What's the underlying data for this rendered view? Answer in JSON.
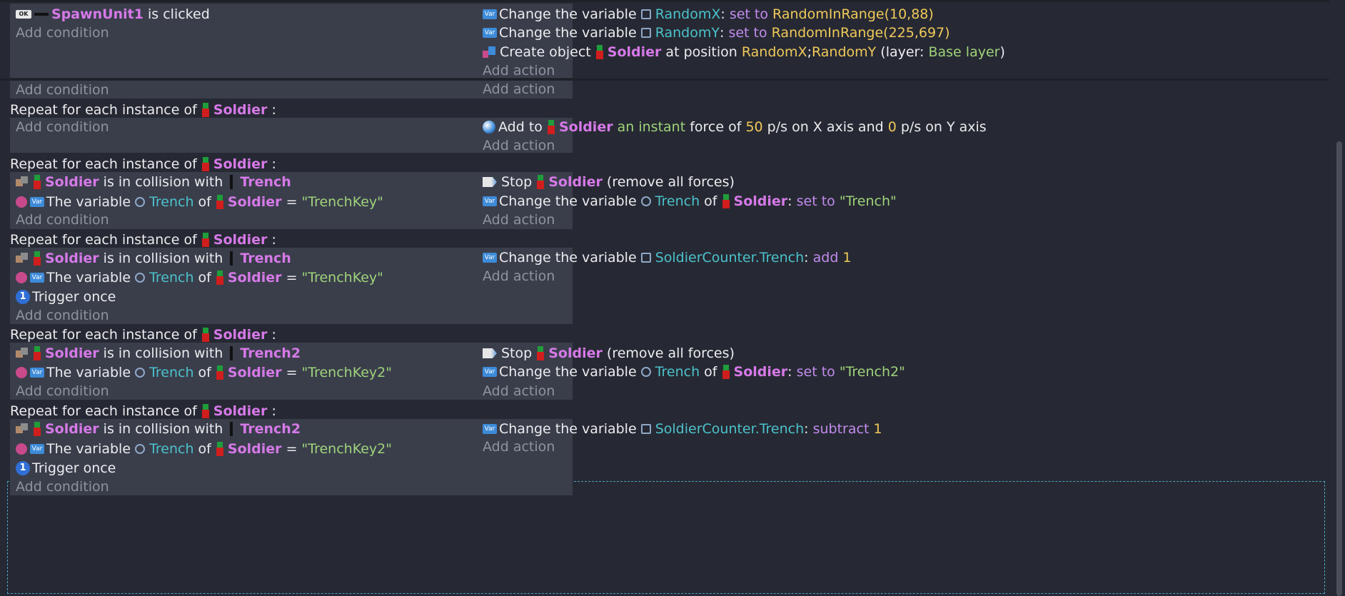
{
  "events": [
    {
      "conditions": [
        {
          "parts": [
            {
              "t": "icon",
              "name": "button-icon",
              "label": "OK"
            },
            {
              "t": "icon",
              "name": "black-bar-icon"
            },
            {
              "t": "obj",
              "v": "SpawnUnit1"
            },
            {
              "t": "plain",
              "v": " is clicked"
            }
          ]
        },
        {
          "parts": [
            {
              "t": "ph",
              "v": "Add condition"
            }
          ]
        }
      ],
      "actions": [
        {
          "parts": [
            {
              "t": "icon",
              "name": "variable-icon",
              "label": "Var"
            },
            {
              "t": "plain",
              "v": "Change the variable "
            },
            {
              "t": "icon",
              "name": "scene-variable-icon"
            },
            {
              "t": "var",
              "v": "RandomX"
            },
            {
              "t": "plain",
              "v": ": "
            },
            {
              "t": "kw",
              "v": "set to "
            },
            {
              "t": "fn",
              "v": "RandomInRange(10,88)"
            }
          ]
        },
        {
          "parts": [
            {
              "t": "icon",
              "name": "variable-icon",
              "label": "Var"
            },
            {
              "t": "plain",
              "v": "Change the variable "
            },
            {
              "t": "icon",
              "name": "scene-variable-icon"
            },
            {
              "t": "var",
              "v": "RandomY"
            },
            {
              "t": "plain",
              "v": ": "
            },
            {
              "t": "kw",
              "v": "set to "
            },
            {
              "t": "fn",
              "v": "RandomInRange(225,697)"
            }
          ]
        },
        {
          "parts": [
            {
              "t": "icon",
              "name": "create-object-icon"
            },
            {
              "t": "plain",
              "v": "Create object "
            },
            {
              "t": "icon",
              "name": "soldier-icon"
            },
            {
              "t": "obj",
              "v": "Soldier"
            },
            {
              "t": "plain",
              "v": " at position "
            },
            {
              "t": "fn",
              "v": "RandomX"
            },
            {
              "t": "plain",
              "v": ";"
            },
            {
              "t": "fn",
              "v": "RandomY"
            },
            {
              "t": "plain",
              "v": " (layer: "
            },
            {
              "t": "grn",
              "v": "Base layer"
            },
            {
              "t": "plain",
              "v": ")"
            }
          ]
        },
        {
          "parts": [
            {
              "t": "ph",
              "v": "Add action"
            }
          ]
        }
      ]
    },
    {
      "conditions": [
        {
          "parts": [
            {
              "t": "ph",
              "v": "Add condition"
            }
          ]
        }
      ],
      "actions": [
        {
          "parts": [
            {
              "t": "ph",
              "v": "Add action"
            }
          ]
        }
      ]
    },
    {
      "header": "Repeat for each instance of",
      "header_obj": "Soldier",
      "conditions": [
        {
          "parts": [
            {
              "t": "ph",
              "v": "Add condition"
            }
          ]
        }
      ],
      "actions": [
        {
          "parts": [
            {
              "t": "icon",
              "name": "force-icon"
            },
            {
              "t": "plain",
              "v": "Add to "
            },
            {
              "t": "icon",
              "name": "soldier-icon"
            },
            {
              "t": "obj",
              "v": "Soldier"
            },
            {
              "t": "plain",
              "v": " "
            },
            {
              "t": "grn",
              "v": "an instant"
            },
            {
              "t": "plain",
              "v": " force of "
            },
            {
              "t": "num",
              "v": "50"
            },
            {
              "t": "plain",
              "v": " p/s on X axis and "
            },
            {
              "t": "num",
              "v": "0"
            },
            {
              "t": "plain",
              "v": " p/s on Y axis"
            }
          ]
        },
        {
          "parts": [
            {
              "t": "ph",
              "v": "Add action"
            }
          ]
        }
      ]
    },
    {
      "header": "Repeat for each instance of",
      "header_obj": "Soldier",
      "conditions": [
        {
          "parts": [
            {
              "t": "icon",
              "name": "collision-icon"
            },
            {
              "t": "icon",
              "name": "soldier-icon"
            },
            {
              "t": "obj",
              "v": "Soldier"
            },
            {
              "t": "plain",
              "v": " is in collision with "
            },
            {
              "t": "icon",
              "name": "trench-icon"
            },
            {
              "t": "obj",
              "v": "Trench"
            }
          ]
        },
        {
          "parts": [
            {
              "t": "icon",
              "name": "compare-icon"
            },
            {
              "t": "icon",
              "name": "variable-icon",
              "label": "Var"
            },
            {
              "t": "plain",
              "v": "The variable "
            },
            {
              "t": "icon",
              "name": "object-variable-icon"
            },
            {
              "t": "var",
              "v": "Trench"
            },
            {
              "t": "plain",
              "v": " of "
            },
            {
              "t": "icon",
              "name": "soldier-icon"
            },
            {
              "t": "obj",
              "v": "Soldier"
            },
            {
              "t": "plain",
              "v": " = "
            },
            {
              "t": "str",
              "v": "\"TrenchKey\""
            }
          ]
        },
        {
          "parts": [
            {
              "t": "ph",
              "v": "Add condition"
            }
          ]
        }
      ],
      "actions": [
        {
          "parts": [
            {
              "t": "icon",
              "name": "stop-icon"
            },
            {
              "t": "plain",
              "v": "Stop "
            },
            {
              "t": "icon",
              "name": "soldier-icon"
            },
            {
              "t": "obj",
              "v": "Soldier"
            },
            {
              "t": "plain",
              "v": " (remove all forces)"
            }
          ]
        },
        {
          "parts": [
            {
              "t": "icon",
              "name": "variable-icon",
              "label": "Var"
            },
            {
              "t": "plain",
              "v": "Change the variable "
            },
            {
              "t": "icon",
              "name": "object-variable-icon"
            },
            {
              "t": "var",
              "v": "Trench"
            },
            {
              "t": "plain",
              "v": " of "
            },
            {
              "t": "icon",
              "name": "soldier-icon"
            },
            {
              "t": "obj",
              "v": "Soldier"
            },
            {
              "t": "plain",
              "v": ": "
            },
            {
              "t": "kw",
              "v": "set to "
            },
            {
              "t": "str",
              "v": "\"Trench\""
            }
          ]
        },
        {
          "parts": [
            {
              "t": "ph",
              "v": "Add action"
            }
          ]
        }
      ]
    },
    {
      "header": "Repeat for each instance of",
      "header_obj": "Soldier",
      "conditions": [
        {
          "parts": [
            {
              "t": "icon",
              "name": "collision-icon"
            },
            {
              "t": "icon",
              "name": "soldier-icon"
            },
            {
              "t": "obj",
              "v": "Soldier"
            },
            {
              "t": "plain",
              "v": " is in collision with "
            },
            {
              "t": "icon",
              "name": "trench-icon"
            },
            {
              "t": "obj",
              "v": "Trench"
            }
          ]
        },
        {
          "parts": [
            {
              "t": "icon",
              "name": "compare-icon"
            },
            {
              "t": "icon",
              "name": "variable-icon",
              "label": "Var"
            },
            {
              "t": "plain",
              "v": "The variable "
            },
            {
              "t": "icon",
              "name": "object-variable-icon"
            },
            {
              "t": "var",
              "v": "Trench"
            },
            {
              "t": "plain",
              "v": " of "
            },
            {
              "t": "icon",
              "name": "soldier-icon"
            },
            {
              "t": "obj",
              "v": "Soldier"
            },
            {
              "t": "plain",
              "v": " = "
            },
            {
              "t": "str",
              "v": "\"TrenchKey\""
            }
          ]
        },
        {
          "parts": [
            {
              "t": "icon",
              "name": "trigger-once-icon",
              "label": "1"
            },
            {
              "t": "plain",
              "v": "Trigger once"
            }
          ]
        },
        {
          "parts": [
            {
              "t": "ph",
              "v": "Add condition"
            }
          ]
        }
      ],
      "actions": [
        {
          "parts": [
            {
              "t": "icon",
              "name": "variable-icon",
              "label": "Var"
            },
            {
              "t": "plain",
              "v": "Change the variable "
            },
            {
              "t": "icon",
              "name": "scene-variable-icon"
            },
            {
              "t": "var",
              "v": "SoldierCounter.Trench"
            },
            {
              "t": "plain",
              "v": ": "
            },
            {
              "t": "kw",
              "v": "add "
            },
            {
              "t": "num",
              "v": "1"
            }
          ]
        },
        {
          "parts": [
            {
              "t": "ph",
              "v": "Add action"
            }
          ]
        }
      ]
    },
    {
      "header": "Repeat for each instance of",
      "header_obj": "Soldier",
      "conditions": [
        {
          "parts": [
            {
              "t": "icon",
              "name": "collision-icon"
            },
            {
              "t": "icon",
              "name": "soldier-icon"
            },
            {
              "t": "obj",
              "v": "Soldier"
            },
            {
              "t": "plain",
              "v": " is in collision with "
            },
            {
              "t": "icon",
              "name": "trench-icon"
            },
            {
              "t": "obj",
              "v": "Trench2"
            }
          ]
        },
        {
          "parts": [
            {
              "t": "icon",
              "name": "compare-icon"
            },
            {
              "t": "icon",
              "name": "variable-icon",
              "label": "Var"
            },
            {
              "t": "plain",
              "v": "The variable "
            },
            {
              "t": "icon",
              "name": "object-variable-icon"
            },
            {
              "t": "var",
              "v": "Trench"
            },
            {
              "t": "plain",
              "v": " of "
            },
            {
              "t": "icon",
              "name": "soldier-icon"
            },
            {
              "t": "obj",
              "v": "Soldier"
            },
            {
              "t": "plain",
              "v": " = "
            },
            {
              "t": "str",
              "v": "\"TrenchKey2\""
            }
          ]
        },
        {
          "parts": [
            {
              "t": "ph",
              "v": "Add condition"
            }
          ]
        }
      ],
      "actions": [
        {
          "parts": [
            {
              "t": "icon",
              "name": "stop-icon"
            },
            {
              "t": "plain",
              "v": "Stop "
            },
            {
              "t": "icon",
              "name": "soldier-icon"
            },
            {
              "t": "obj",
              "v": "Soldier"
            },
            {
              "t": "plain",
              "v": " (remove all forces)"
            }
          ]
        },
        {
          "parts": [
            {
              "t": "icon",
              "name": "variable-icon",
              "label": "Var"
            },
            {
              "t": "plain",
              "v": "Change the variable "
            },
            {
              "t": "icon",
              "name": "object-variable-icon"
            },
            {
              "t": "var",
              "v": "Trench"
            },
            {
              "t": "plain",
              "v": " of "
            },
            {
              "t": "icon",
              "name": "soldier-icon"
            },
            {
              "t": "obj",
              "v": "Soldier"
            },
            {
              "t": "plain",
              "v": ": "
            },
            {
              "t": "kw",
              "v": "set to "
            },
            {
              "t": "str",
              "v": "\"Trench2\""
            }
          ]
        },
        {
          "parts": [
            {
              "t": "ph",
              "v": "Add action"
            }
          ]
        }
      ]
    },
    {
      "header": "Repeat for each instance of",
      "header_obj": "Soldier",
      "conditions": [
        {
          "parts": [
            {
              "t": "icon",
              "name": "collision-icon"
            },
            {
              "t": "icon",
              "name": "soldier-icon"
            },
            {
              "t": "obj",
              "v": "Soldier"
            },
            {
              "t": "plain",
              "v": " is in collision with "
            },
            {
              "t": "icon",
              "name": "trench-icon"
            },
            {
              "t": "obj",
              "v": "Trench2"
            }
          ]
        },
        {
          "parts": [
            {
              "t": "icon",
              "name": "compare-icon"
            },
            {
              "t": "icon",
              "name": "variable-icon",
              "label": "Var"
            },
            {
              "t": "plain",
              "v": "The variable "
            },
            {
              "t": "icon",
              "name": "object-variable-icon"
            },
            {
              "t": "var",
              "v": "Trench"
            },
            {
              "t": "plain",
              "v": " of "
            },
            {
              "t": "icon",
              "name": "soldier-icon"
            },
            {
              "t": "obj",
              "v": "Soldier"
            },
            {
              "t": "plain",
              "v": " = "
            },
            {
              "t": "str",
              "v": "\"TrenchKey2\""
            }
          ]
        },
        {
          "parts": [
            {
              "t": "icon",
              "name": "trigger-once-icon",
              "label": "1"
            },
            {
              "t": "plain",
              "v": "Trigger once"
            }
          ]
        },
        {
          "parts": [
            {
              "t": "ph",
              "v": "Add condition"
            }
          ]
        }
      ],
      "actions": [
        {
          "parts": [
            {
              "t": "icon",
              "name": "variable-icon",
              "label": "Var"
            },
            {
              "t": "plain",
              "v": "Change the variable "
            },
            {
              "t": "icon",
              "name": "scene-variable-icon"
            },
            {
              "t": "var",
              "v": "SoldierCounter.Trench"
            },
            {
              "t": "plain",
              "v": ": "
            },
            {
              "t": "kw",
              "v": "subtract "
            },
            {
              "t": "num",
              "v": "1"
            }
          ]
        },
        {
          "parts": [
            {
              "t": "ph",
              "v": "Add action"
            }
          ]
        }
      ]
    }
  ]
}
